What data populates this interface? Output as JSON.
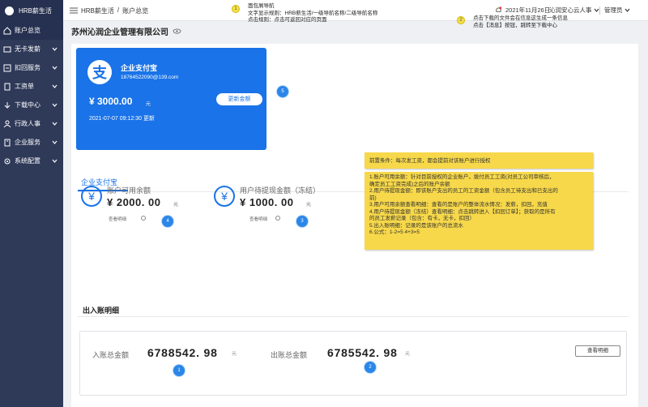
{
  "app": {
    "name": "HRB薪生活"
  },
  "sidebar": {
    "items": [
      {
        "label": "账户总览",
        "icon": "home-icon",
        "active": true
      },
      {
        "label": "无卡发薪",
        "icon": "card-icon"
      },
      {
        "label": "扣回服务",
        "icon": "return-icon"
      },
      {
        "label": "工资单",
        "icon": "doc-icon"
      },
      {
        "label": "下载中心",
        "icon": "download-icon"
      },
      {
        "label": "行政人事",
        "icon": "people-icon"
      },
      {
        "label": "企业服务",
        "icon": "building-icon"
      },
      {
        "label": "系统配置",
        "icon": "settings-icon"
      }
    ]
  },
  "topbar": {
    "crumb1": "HRB薪生活",
    "crumb_sep": "/",
    "crumb2": "账户总览",
    "ann1_lines": [
      "面包屑导航",
      "文字显示规则：HRB薪生活/一级导航名称/二级导航名称",
      "点击规则：点击可返回对应的页面"
    ],
    "ann1_badge": "1",
    "ann2_lines": [
      "点击下载的文件会在信息这生成一条信息",
      "点击【消息】按钮，跳转至下载中心"
    ],
    "ann2_badge": "2",
    "date": "2021年11月26日",
    "user": "沁润安心云人事",
    "role": "管理员"
  },
  "company": {
    "name": "苏州沁润企业管理有限公司"
  },
  "account_card": {
    "title": "企业支付宝",
    "email": "18764522090@139.com",
    "amount": "¥ 3000.00",
    "unit": "元",
    "update_button": "更新金额",
    "time": "2021-07-07 09:12:30 更新",
    "badge": "5",
    "accent": "#1a73e8"
  },
  "tab": {
    "label": "企业支付宝"
  },
  "stats": [
    {
      "label": "账户可用余额",
      "value": "¥ 2000. 00",
      "unit": "元",
      "link": "查看明细",
      "badge": "4"
    },
    {
      "label": "用户待提现金额（冻结）",
      "value": "¥ 1000. 00",
      "unit": "元",
      "link": "查看明细",
      "badge": "3"
    }
  ],
  "notes": {
    "box1": "前置条件：每次发工资，都会提前对该账户进行授权",
    "box2": [
      "1.账户可用余额：针对目前授权的企业账户，拨付员工工资(对员工公司审核后，",
      "确定员工工资完成)之后的账户余额",
      "2.用户待提现金额：即该账户支出的员工的工资金额（包含员工待支出和已支出的",
      "前)",
      "3.用户可用余额查看明细：查看的是账户的整体流水情况：发薪，扣回，充值",
      "4.用户待提现金额（冻结）查看明细：点击跳转进入【扣回订单】；获取的是所有",
      "的员工发薪记录（包含：有卡，无卡，扣回）",
      "5.出入账明细：记录的是该账户的总流水",
      "6.公式：1-2=5        4+3=5"
    ]
  },
  "ledger": {
    "title": "出入账明细",
    "in_label": "入账总金额",
    "in_value": "6788542. 98",
    "in_unit": "元",
    "in_badge": "1",
    "out_label": "出账总金额",
    "out_value": "6785542. 98",
    "out_unit": "元",
    "out_badge": "2",
    "detail_button": "查看明细"
  }
}
